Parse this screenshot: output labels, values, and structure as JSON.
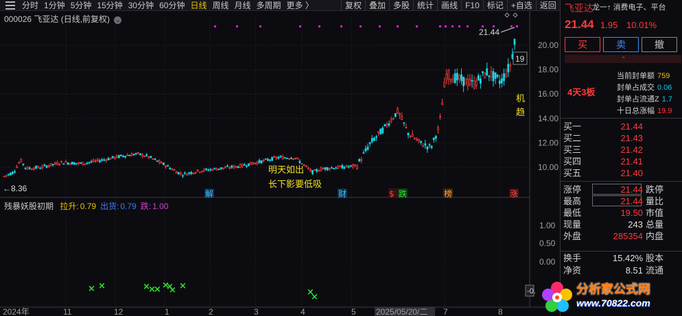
{
  "toolbar": {
    "periods": [
      "分时",
      "1分钟",
      "5分钟",
      "15分钟",
      "30分钟",
      "60分钟",
      "日线",
      "周线",
      "月线",
      "多周期",
      "更多 〉"
    ],
    "active_period": "日线",
    "tools": [
      "复权",
      "叠加",
      "多股",
      "统计",
      "画线",
      "F10",
      "标记",
      "+自选",
      "返回"
    ]
  },
  "chart": {
    "stock_code": "000026",
    "stock_title": "飞亚达 (日线,前复权)",
    "high_label": "21.44",
    "low_label": "8.36",
    "y_ticks": [
      "20.00",
      "18.00",
      "16.00",
      "14.00",
      "12.00",
      "10.00"
    ],
    "right_partial_label": "19",
    "annotation_line1": "明天如出",
    "annotation_line2": "长下影要低吸",
    "right_annotation_1": "机",
    "right_annotation_2": "趋",
    "event_markers": [
      "解",
      "财",
      "$",
      "跌",
      "榜",
      "涨"
    ],
    "x_labels": [
      "2024年",
      "11",
      "12",
      "1",
      "2",
      "3",
      "4",
      "5",
      "2025/05/20/二",
      "7",
      "8"
    ]
  },
  "indicator": {
    "name": "残暴妖股初期",
    "items": [
      {
        "label": "拉升:",
        "value": "0.79",
        "color": "#e8c200"
      },
      {
        "label": "出货:",
        "value": "0.79",
        "color": "#3c78ff"
      },
      {
        "label": "跌:",
        "value": "1.00",
        "color": "#d040d0"
      }
    ],
    "y_ticks": [
      "1.00",
      "0.50",
      "0.00"
    ],
    "partial_tick": "-0."
  },
  "side": {
    "name": "飞亚达",
    "concepts": "龙一↑ 消费电子、平台",
    "price": "21.44",
    "change": "1.95",
    "pct": "10.01%",
    "buy": "买",
    "sell": "卖",
    "cancel": "撤",
    "board": "4天3板",
    "seal": [
      {
        "label": "当前封单额",
        "value": "759",
        "color": "#e8c200"
      },
      {
        "label": "封单占成交",
        "value": "0.06",
        "color": "#18c8e8"
      },
      {
        "label": "封单占流通Z",
        "value": "1.7",
        "color": "#18c8e8"
      },
      {
        "label": "十日总涨幅",
        "value": "19.9",
        "color": "#ff3a3a"
      }
    ],
    "orderbook": [
      {
        "label": "买一",
        "value": "21.44"
      },
      {
        "label": "买二",
        "value": "21.43"
      },
      {
        "label": "买三",
        "value": "21.42"
      },
      {
        "label": "买四",
        "value": "21.41"
      },
      {
        "label": "买五",
        "value": "21.40"
      }
    ],
    "quotes": [
      {
        "label": "涨停",
        "value": "21.44",
        "label2": "跌停",
        "color": "red",
        "boxed": true
      },
      {
        "label": "最高",
        "value": "21.44",
        "label2": "量比",
        "color": "red",
        "boxed": true
      },
      {
        "label": "最低",
        "value": "19.50",
        "label2": "市值",
        "color": "red",
        "boxed": false
      },
      {
        "label": "现量",
        "value": "243",
        "label2": "总量",
        "color": "white",
        "boxed": false
      },
      {
        "label": "外盘",
        "value": "285354",
        "label2": "内盘",
        "color": "red",
        "boxed": false
      }
    ],
    "quotes2": [
      {
        "label": "换手",
        "value": "15.42%",
        "label2": "股本",
        "color": "white"
      },
      {
        "label": "净资",
        "value": "8.51",
        "label2": "流通",
        "color": "white"
      }
    ]
  },
  "watermark": {
    "text": "分析家公式网",
    "url": "www.70822.com"
  }
}
